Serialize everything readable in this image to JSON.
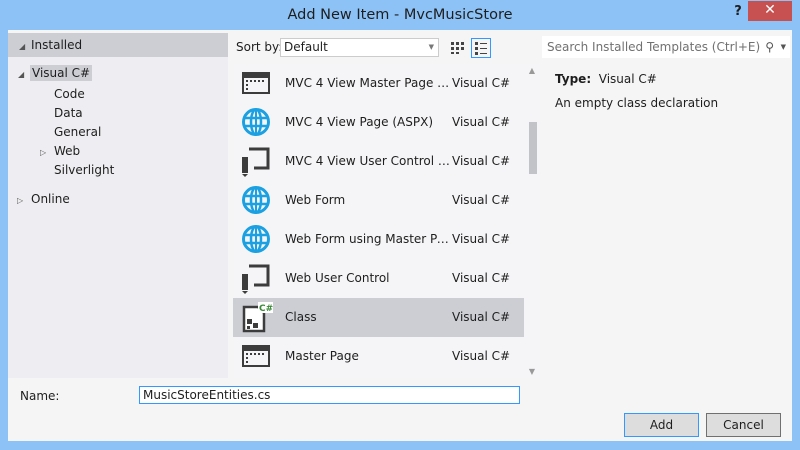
{
  "window": {
    "title": "Add New Item - MvcMusicStore",
    "help": "?",
    "close": "✕"
  },
  "tree": {
    "installed": "Installed",
    "visual_csharp": "Visual C#",
    "children": [
      "Code",
      "Data",
      "General",
      "Web",
      "Silverlight"
    ],
    "online": "Online"
  },
  "sort": {
    "label": "Sort by:",
    "value": "Default"
  },
  "search": {
    "placeholder": "Search Installed Templates (Ctrl+E)"
  },
  "templates": [
    {
      "name": "MVC 4 View Master Page (ASPX)",
      "type": "Visual C#",
      "icon": "master-page-icon"
    },
    {
      "name": "MVC 4 View Page (ASPX)",
      "type": "Visual C#",
      "icon": "globe-icon"
    },
    {
      "name": "MVC 4 View User Control (ASPX)",
      "type": "Visual C#",
      "icon": "user-control-icon"
    },
    {
      "name": "Web Form",
      "type": "Visual C#",
      "icon": "globe-icon"
    },
    {
      "name": "Web Form using Master Page",
      "type": "Visual C#",
      "icon": "globe-icon"
    },
    {
      "name": "Web User Control",
      "type": "Visual C#",
      "icon": "user-control-icon"
    },
    {
      "name": "Class",
      "type": "Visual C#",
      "icon": "class-icon",
      "selected": true
    },
    {
      "name": "Master Page",
      "type": "Visual C#",
      "icon": "master-page-icon"
    }
  ],
  "details": {
    "type_label": "Type:",
    "type_value": "Visual C#",
    "description": "An empty class declaration"
  },
  "name": {
    "label": "Name:",
    "value": "MusicStoreEntities.cs"
  },
  "buttons": {
    "add": "Add",
    "cancel": "Cancel"
  },
  "colors": {
    "frame": "#8dc2f7",
    "selection": "#ccced3",
    "accent": "#3399ff",
    "close": "#c75050",
    "globe": "#1ba1e2"
  }
}
